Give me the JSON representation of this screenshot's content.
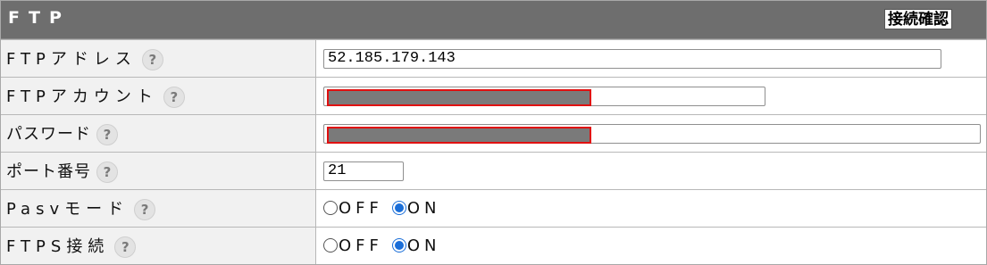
{
  "header": {
    "title": "FTP",
    "check_button": "接続確認"
  },
  "help_glyph": "?",
  "rows": {
    "ftp_address": {
      "label": "FTPアドレス",
      "value": "52.185.179.143"
    },
    "ftp_account": {
      "label": "FTPアカウント",
      "value": ""
    },
    "password": {
      "label": "パスワード",
      "value": ""
    },
    "port": {
      "label": "ポート番号",
      "value": "21"
    },
    "pasv_mode": {
      "label": "Pasvモード",
      "options": [
        "OFF",
        "ON"
      ],
      "selected": "ON"
    },
    "ftps": {
      "label": "FTPS接続",
      "options": [
        "OFF",
        "ON"
      ],
      "selected": "ON"
    }
  },
  "colors": {
    "header_bg": "#6e6e6e",
    "label_bg": "#f1f1f1",
    "redaction_fill": "#7a7a7a",
    "redaction_border": "#e01010",
    "radio_selected": "#1a6ed8"
  }
}
